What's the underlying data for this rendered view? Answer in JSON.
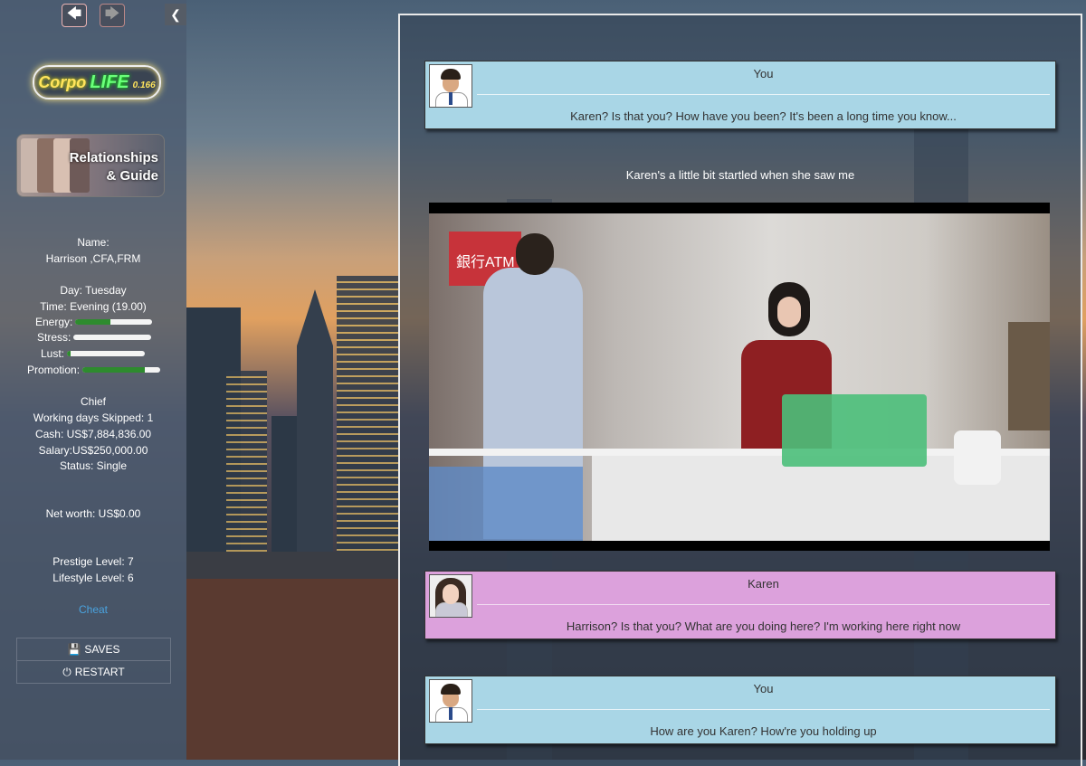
{
  "sidebar": {
    "back_icon": "arrow-left-icon",
    "forward_icon": "arrow-right-icon",
    "collapse_icon": "chevron-left-icon",
    "logo": {
      "word1": "Corpo",
      "word2": "LIFE",
      "version": "0.166"
    },
    "guide_label_1": "Relationships",
    "guide_label_2": "& Guide",
    "name_label": "Name:",
    "name_value": "Harrison ,CFA,FRM",
    "day": "Day: Tuesday",
    "time": "Time: Evening (19.00)",
    "bars": [
      {
        "label": "Energy:",
        "fill": 0.45,
        "color": "#2e8b2e"
      },
      {
        "label": "Stress:",
        "fill": 0.0,
        "color": "#2e8b2e"
      },
      {
        "label": "Lust:",
        "fill": 0.05,
        "color": "#2e8b2e"
      },
      {
        "label": "Promotion:",
        "fill": 0.8,
        "color": "#2e8b2e"
      }
    ],
    "title": "Chief",
    "working_days_skipped": "Working days Skipped: 1",
    "cash": "Cash: US$7,884,836.00",
    "salary": "Salary:US$250,000.00",
    "status": "Status: Single",
    "net_worth": "Net worth: US$0.00",
    "prestige": "Prestige Level: 7",
    "lifestyle": "Lifestyle Level: 6",
    "cheat": "Cheat",
    "saves": "SAVES",
    "restart": "RESTART"
  },
  "main": {
    "messages": [
      {
        "speaker": "You",
        "text": "Karen? Is that you? How have you been? It's been a long time you know..."
      },
      {
        "speaker": "Karen",
        "text": "Harrison? Is that you? What are you doing here? I'm working here right now"
      },
      {
        "speaker": "You",
        "text": "How are you Karen? How're you holding up"
      }
    ],
    "narration": "Karen's a little bit startled when she saw me",
    "scene_sign": "銀行ATM"
  },
  "colors": {
    "you_bubble": "#a9d6e6",
    "karen_bubble": "#dca1dc",
    "bar_fill": "#2e8b2e",
    "cheat_link": "#4aa3df"
  }
}
